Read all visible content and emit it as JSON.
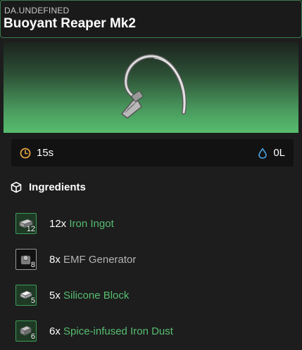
{
  "item": {
    "subtitle": "DA.UNDEFINED",
    "title": "Buoyant Reaper Mk2",
    "image_icon": "curved-blade-icon"
  },
  "stats": {
    "time": {
      "icon": "clock-icon",
      "value": "15s"
    },
    "water": {
      "icon": "water-drop-icon",
      "value": "0L"
    }
  },
  "ingredients": {
    "heading": "Ingredients",
    "heading_icon": "box-icon",
    "items": [
      {
        "count": "12",
        "qty": "12x",
        "name": "Iron Ingot",
        "name_color": "#57bd6e",
        "icon": "iron-ingot-icon"
      },
      {
        "count": "8",
        "qty": "8x",
        "name": "EMF Generator",
        "name_color": "#b4b4b4",
        "icon": "emf-generator-icon"
      },
      {
        "count": "5",
        "qty": "5x",
        "name": "Silicone Block",
        "name_color": "#57bd6e",
        "icon": "silicone-block-icon"
      },
      {
        "count": "6",
        "qty": "6x",
        "name": "Spice-infused Iron Dust",
        "name_color": "#57bd6e",
        "icon": "iron-dust-icon"
      }
    ]
  },
  "colors": {
    "accent_green": "#57bd6e",
    "header_border": "#3b7a4e",
    "stats_bg": "#121213",
    "time_icon": "#e5a542",
    "water_icon": "#4aa3e0"
  }
}
